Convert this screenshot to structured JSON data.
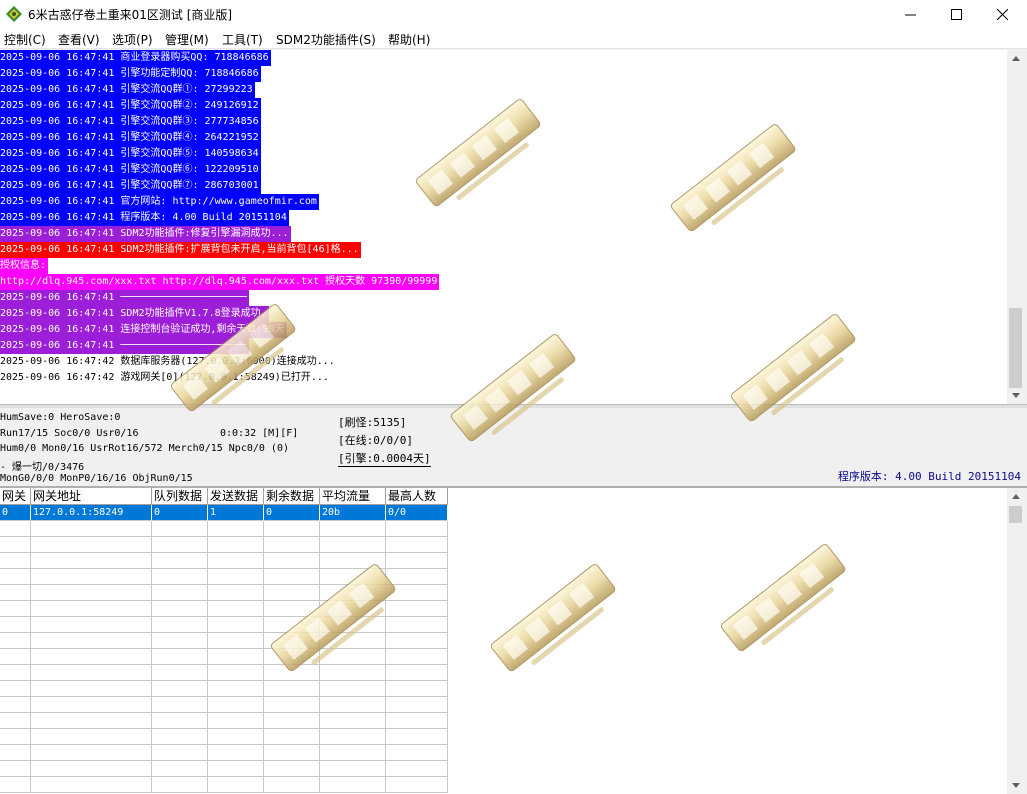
{
  "window": {
    "title": "6米古惑仔卷土重来01区测试 [商业版]",
    "minimize_icon": "minimize-icon",
    "maximize_icon": "maximize-icon",
    "close_icon": "close-icon"
  },
  "menu": [
    "控制(C)",
    "查看(V)",
    "选项(P)",
    "管理(M)",
    "工具(T)",
    "SDM2功能插件(S)",
    "帮助(H)"
  ],
  "log": [
    {
      "text": "2025-09-06 16:47:41 商业登录器购买QQ: 718846686",
      "bg": "#0000ff",
      "fg": "#ffffff"
    },
    {
      "text": "2025-09-06 16:47:41 引擎功能定制QQ: 718846686",
      "bg": "#0000ff",
      "fg": "#ffffff"
    },
    {
      "text": "2025-09-06 16:47:41 引擎交流QQ群①: 27299223",
      "bg": "#0000ff",
      "fg": "#ffffff"
    },
    {
      "text": "2025-09-06 16:47:41 引擎交流QQ群②: 249126912",
      "bg": "#0000ff",
      "fg": "#ffffff"
    },
    {
      "text": "2025-09-06 16:47:41 引擎交流QQ群③: 277734856",
      "bg": "#0000ff",
      "fg": "#ffffff"
    },
    {
      "text": "2025-09-06 16:47:41 引擎交流QQ群④: 264221952",
      "bg": "#0000ff",
      "fg": "#ffffff"
    },
    {
      "text": "2025-09-06 16:47:41 引擎交流QQ群⑤: 140598634",
      "bg": "#0000ff",
      "fg": "#ffffff"
    },
    {
      "text": "2025-09-06 16:47:41 引擎交流QQ群⑥: 122209510",
      "bg": "#0000ff",
      "fg": "#ffffff"
    },
    {
      "text": "2025-09-06 16:47:41 引擎交流QQ群⑦: 286703001",
      "bg": "#0000ff",
      "fg": "#ffffff"
    },
    {
      "text": "2025-09-06 16:47:41 官方网站: http://www.gameofmir.com",
      "bg": "#0000ff",
      "fg": "#ffffff"
    },
    {
      "text": "2025-09-06 16:47:41 程序版本: 4.00 Build 20151104",
      "bg": "#0000ff",
      "fg": "#ffffff"
    },
    {
      "text": "2025-09-06 16:47:41 SDM2功能插件:修复引擎漏洞成功...",
      "bg": "#9c1ed8",
      "fg": "#ffffff"
    },
    {
      "text": "2025-09-06 16:47:41 SDM2功能插件:扩展背包未开启,当前背包[46]格...",
      "bg": "#ff0000",
      "fg": "#ffffff"
    },
    {
      "text": "授权信息:",
      "bg": "#ff00ff",
      "fg": "#ffffff"
    },
    {
      "text": "http://dlq.945.com/xxx.txt http://dlq.945.com/xxx.txt 授权天数 97390/99999",
      "bg": "#ff00ff",
      "fg": "#ffffff"
    },
    {
      "text": "2025-09-06 16:47:41 ─────────────────────",
      "bg": "#9c1ed8",
      "fg": "#ffffff"
    },
    {
      "text": "2025-09-06 16:47:41 SDM2功能插件V1.7.8登录成功.",
      "bg": "#9c1ed8",
      "fg": "#ffffff"
    },
    {
      "text": "2025-09-06 16:47:41 连接控制台验证成功,剩余天数:90天",
      "bg": "#9c1ed8",
      "fg": "#ffffff"
    },
    {
      "text": "2025-09-06 16:47:41 ─────────────────────",
      "bg": "#9c1ed8",
      "fg": "#ffffff"
    },
    {
      "text": "2025-09-06 16:47:42 数据库服务器(127.0.0.1:6000)连接成功...",
      "bg": "#ffffff",
      "fg": "#000000"
    },
    {
      "text": "2025-09-06 16:47:42 游戏网关[0](127.0.0.1:58249)已打开...",
      "bg": "#ffffff",
      "fg": "#000000"
    }
  ],
  "status": {
    "line1": "HumSave:0 HeroSave:0",
    "line2": "Run17/15 Soc0/0 Usr0/16",
    "time": "0:0:32 [M][F]",
    "line3": "Hum0/0 Mon0/16 UsrRot16/572 Merch0/15 Npc0/0 (0)",
    "line4": " - 爆一切/0/3476",
    "line5": "MonG0/0/0 MonP0/16/16 ObjRun0/15",
    "refresh": "[刷怪:5135]",
    "online": "[在线:0/0/0]",
    "engine": "[引擎:0.0004天]",
    "version": "程序版本: 4.00 Build 20151104"
  },
  "table": {
    "columns": [
      "网关",
      "网关地址",
      "队列数据",
      "发送数据",
      "剩余数据",
      "平均流量",
      "最高人数"
    ],
    "rows": [
      [
        "0",
        "127.0.0.1:58249",
        "0",
        "1",
        "0",
        "20b",
        "0/0"
      ]
    ]
  },
  "colors": {
    "selection": "#0078d7",
    "version_text": "#0a0a8a"
  }
}
